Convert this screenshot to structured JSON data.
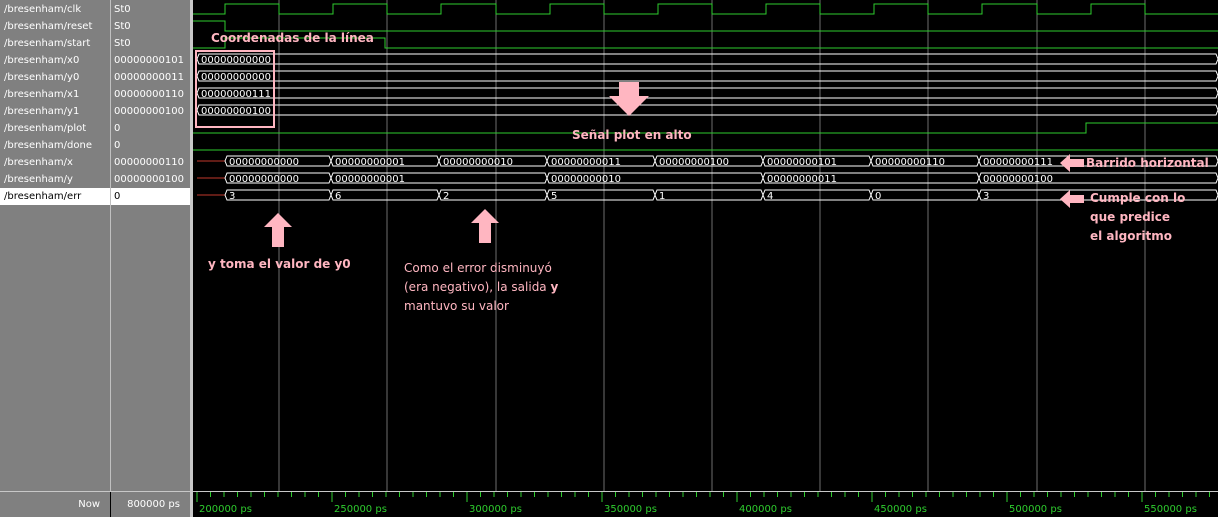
{
  "signals": [
    {
      "name": "/bresenham/clk",
      "value": "St0"
    },
    {
      "name": "/bresenham/reset",
      "value": "St0"
    },
    {
      "name": "/bresenham/start",
      "value": "St0"
    },
    {
      "name": "/bresenham/x0",
      "value": "00000000101"
    },
    {
      "name": "/bresenham/y0",
      "value": "00000000011"
    },
    {
      "name": "/bresenham/x1",
      "value": "00000000110"
    },
    {
      "name": "/bresenham/y1",
      "value": "00000000100"
    },
    {
      "name": "/bresenham/plot",
      "value": "0"
    },
    {
      "name": "/bresenham/done",
      "value": "0"
    },
    {
      "name": "/bresenham/x",
      "value": "00000000110"
    },
    {
      "name": "/bresenham/y",
      "value": "00000000100"
    },
    {
      "name": "/bresenham/err",
      "value": "0"
    }
  ],
  "bus_values": {
    "x0": [
      "00000000000"
    ],
    "y0": [
      "00000000000"
    ],
    "x1": [
      "00000000111"
    ],
    "y1": [
      "00000000100"
    ],
    "x": [
      "00000000000",
      "00000000001",
      "00000000010",
      "00000000011",
      "00000000100",
      "00000000101",
      "00000000110",
      "00000000111"
    ],
    "y": [
      "00000000000",
      "00000000001",
      "00000000010",
      "00000000011",
      "00000000100"
    ],
    "err": [
      "3",
      "6",
      "2",
      "5",
      "1",
      "4",
      "0",
      "3"
    ]
  },
  "footer": {
    "now_label": "Now",
    "now_value": "800000 ps",
    "ticks": [
      "200000 ps",
      "250000 ps",
      "300000 ps",
      "350000 ps",
      "400000 ps",
      "450000 ps",
      "500000 ps",
      "550000 ps"
    ]
  },
  "annotations": {
    "coords": "Coordenadas de la línea",
    "plot_high": "Señal plot en alto",
    "barrido": "Barrido horizontal",
    "cumple_1": "Cumple con lo",
    "cumple_2": "que predice",
    "cumple_3": "el algoritmo",
    "y_toma_1": "y toma el valor de ",
    "y_toma_2": "y0",
    "error_1": "Como el error disminuyó",
    "error_2": "(era negativo), la salida ",
    "error_2b": "y",
    "error_3": "mantuvo su valor"
  },
  "colors": {
    "wave": "#2ecc2e",
    "cursor": "#c8c8c8",
    "annotation": "#ffb6c1",
    "bus_text": "#ffffff"
  }
}
